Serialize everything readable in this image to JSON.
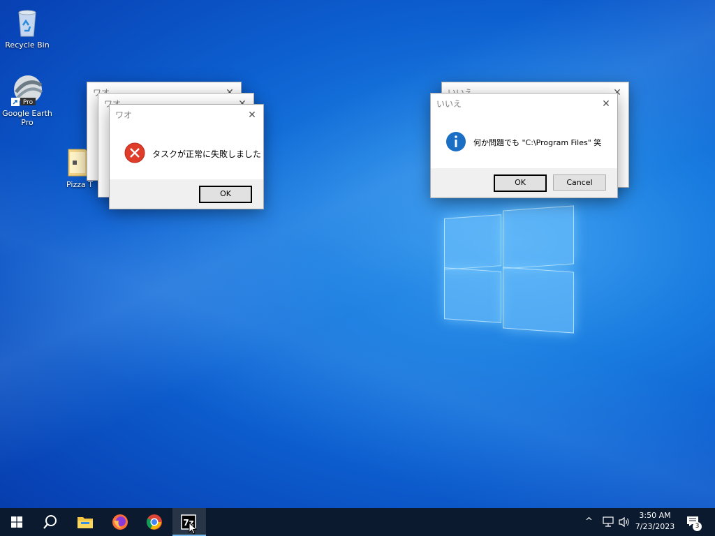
{
  "desktop": {
    "icons": [
      {
        "label": "Recycle Bin"
      },
      {
        "label_line1": "Google Earth",
        "label_line2": "Pro",
        "badge": "Pro"
      },
      {
        "label": "Pizza T"
      }
    ]
  },
  "dialogs": {
    "back1": {
      "title": "ワオ"
    },
    "back2": {
      "title": "ワオ"
    },
    "error": {
      "title": "ワオ",
      "message": "タスクが正常に失敗しました",
      "ok": "OK"
    },
    "info_back": {
      "title": "いいえ"
    },
    "info": {
      "title": "いいえ",
      "message": "何か問題でも \"C:\\Program Files\" 笑",
      "ok": "OK",
      "cancel": "Cancel"
    }
  },
  "taskbar": {
    "time": "3:50 AM",
    "date": "7/23/2023",
    "notifications": "3",
    "icons": [
      "start-icon",
      "search-icon",
      "file-explorer-icon",
      "firefox-icon",
      "chrome-icon",
      "7zip-icon"
    ]
  },
  "colors": {
    "error": "#e03c2a",
    "info": "#1a6fc4",
    "taskbar": "#0b1a2e"
  }
}
